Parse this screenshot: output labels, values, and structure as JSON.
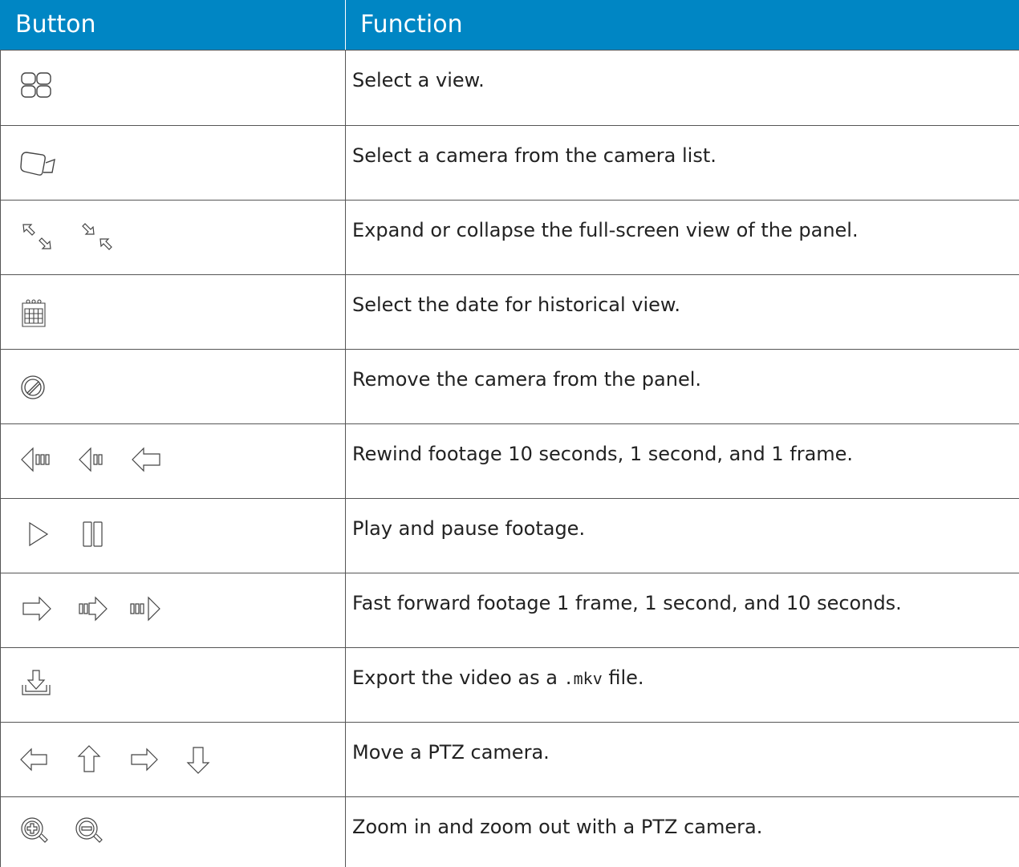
{
  "header": {
    "col_button": "Button",
    "col_function": "Function"
  },
  "rows": [
    {
      "icons": [
        "views-grid-icon"
      ],
      "text": "Select a view."
    },
    {
      "icons": [
        "camera-icon"
      ],
      "text": "Select a camera from the camera list."
    },
    {
      "icons": [
        "expand-fullscreen-icon",
        "collapse-fullscreen-icon"
      ],
      "text": "Expand or collapse the full-screen view of the panel."
    },
    {
      "icons": [
        "calendar-icon"
      ],
      "text": "Select the date for historical view."
    },
    {
      "icons": [
        "remove-camera-icon"
      ],
      "text": "Remove the camera from the panel."
    },
    {
      "icons": [
        "rewind-10-seconds-icon",
        "rewind-1-second-icon",
        "rewind-1-frame-icon"
      ],
      "text": "Rewind footage 10 seconds, 1 second, and 1 frame."
    },
    {
      "icons": [
        "play-icon",
        "pause-icon"
      ],
      "text": "Play and pause footage."
    },
    {
      "icons": [
        "forward-1-frame-icon",
        "forward-1-second-icon",
        "forward-10-seconds-icon"
      ],
      "text": "Fast forward footage 1 frame, 1 second, and 10 seconds."
    },
    {
      "icons": [
        "export-download-icon"
      ],
      "text_before": "Export the video as a ",
      "text_code": ".mkv",
      "text_after": " file."
    },
    {
      "icons": [
        "ptz-left-arrow-icon",
        "ptz-up-arrow-icon",
        "ptz-right-arrow-icon",
        "ptz-down-arrow-icon"
      ],
      "text": "Move a PTZ camera."
    },
    {
      "icons": [
        "zoom-in-icon",
        "zoom-out-icon"
      ],
      "text": "Zoom in and zoom out with a PTZ camera."
    }
  ],
  "colors": {
    "header_bg": "#0086c4",
    "header_text": "#ffffff",
    "border": "#555555",
    "icon_stroke": "#444444"
  }
}
